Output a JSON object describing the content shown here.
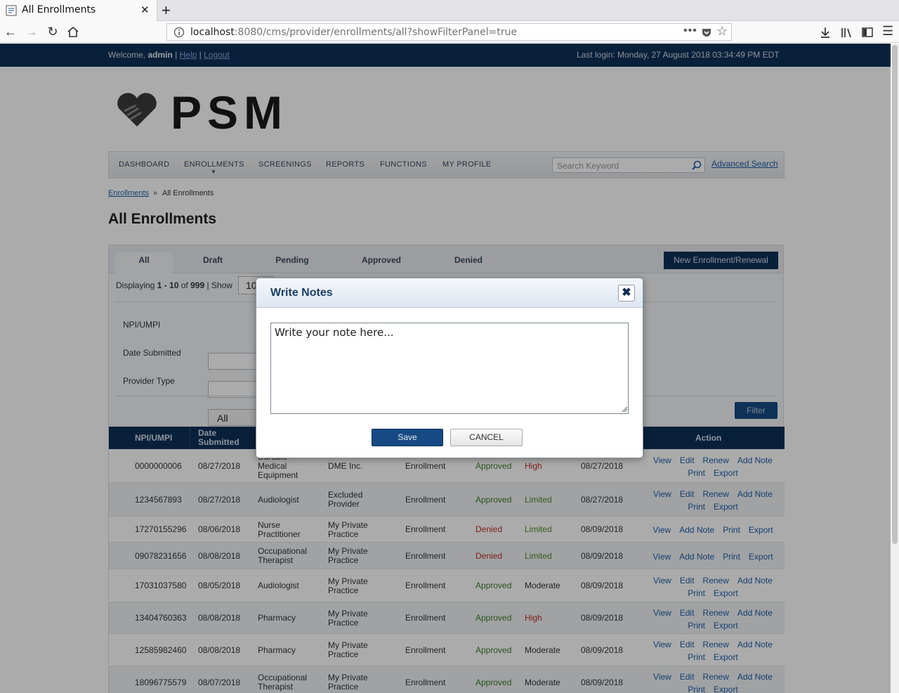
{
  "browser": {
    "tab_title": "All Enrollments",
    "url_host": "localhost",
    "url_rest": ":8080/cms/provider/enrollments/all?showFilterPanel=true"
  },
  "topbar": {
    "welcome": "Welcome,",
    "user": "admin",
    "help": "Help",
    "logout": "Logout",
    "last_login": "Last login: Monday, 27 August 2018 03:34:49 PM EDT"
  },
  "logo": {
    "text": "PSM"
  },
  "menu": {
    "items": [
      "DASHBOARD",
      "ENROLLMENTS",
      "SCREENINGS",
      "REPORTS",
      "FUNCTIONS",
      "MY PROFILE"
    ],
    "search_placeholder": "Search Keyword",
    "advanced_search": "Advanced Search"
  },
  "breadcrumb": {
    "link": "Enrollments",
    "sep": "»",
    "current": "All Enrollments"
  },
  "page_title": "All Enrollments",
  "tabs": [
    "All",
    "Draft",
    "Pending",
    "Approved",
    "Denied"
  ],
  "new_enrollment": "New Enrollment/Renewal",
  "display": {
    "prefix": "Displaying",
    "range": "1 - 10",
    "of": "of",
    "total": "999",
    "show": "| Show",
    "show_value": "10"
  },
  "filters": {
    "npi": "NPI/UMPI",
    "date": "Date Submitted",
    "provider_type": "Provider Type",
    "provider_type_value": "All",
    "filter_btn": "Filter"
  },
  "table": {
    "headers": [
      "NPI/UMPI",
      "Date Submitted",
      "Action"
    ],
    "rows": [
      {
        "npi": "0000000006",
        "date": "08/27/2018",
        "type": "Durable Medical Equipment",
        "name": "DME Inc.",
        "req": "Enrollment",
        "status": "Approved",
        "risk": "High",
        "updated": "08/27/2018",
        "actions": [
          "View",
          "Edit",
          "Renew",
          "Add Note",
          "Print",
          "Export"
        ]
      },
      {
        "npi": "1234567893",
        "date": "08/27/2018",
        "type": "Audiologist",
        "name": "Excluded Provider",
        "req": "Enrollment",
        "status": "Approved",
        "risk": "Limited",
        "updated": "08/27/2018",
        "actions": [
          "View",
          "Edit",
          "Renew",
          "Add Note",
          "Print",
          "Export"
        ]
      },
      {
        "npi": "17270155296",
        "date": "08/06/2018",
        "type": "Nurse Practitioner",
        "name": "My Private Practice",
        "req": "Enrollment",
        "status": "Denied",
        "risk": "Limited",
        "updated": "08/09/2018",
        "actions": [
          "View",
          "Add Note",
          "Print",
          "Export"
        ]
      },
      {
        "npi": "09078231656",
        "date": "08/08/2018",
        "type": "Occupational Therapist",
        "name": "My Private Practice",
        "req": "Enrollment",
        "status": "Denied",
        "risk": "Limited",
        "updated": "08/09/2018",
        "actions": [
          "View",
          "Add Note",
          "Print",
          "Export"
        ]
      },
      {
        "npi": "17031037580",
        "date": "08/05/2018",
        "type": "Audiologist",
        "name": "My Private Practice",
        "req": "Enrollment",
        "status": "Approved",
        "risk": "Moderate",
        "updated": "08/09/2018",
        "actions": [
          "View",
          "Edit",
          "Renew",
          "Add Note",
          "Print",
          "Export"
        ]
      },
      {
        "npi": "13404760363",
        "date": "08/08/2018",
        "type": "Pharmacy",
        "name": "My Private Practice",
        "req": "Enrollment",
        "status": "Approved",
        "risk": "High",
        "updated": "08/09/2018",
        "actions": [
          "View",
          "Edit",
          "Renew",
          "Add Note",
          "Print",
          "Export"
        ]
      },
      {
        "npi": "12585982460",
        "date": "08/08/2018",
        "type": "Pharmacy",
        "name": "My Private Practice",
        "req": "Enrollment",
        "status": "Approved",
        "risk": "Moderate",
        "updated": "08/09/2018",
        "actions": [
          "View",
          "Edit",
          "Renew",
          "Add Note",
          "Print",
          "Export"
        ]
      },
      {
        "npi": "18096775579",
        "date": "08/07/2018",
        "type": "Occupational Therapist",
        "name": "My Private Practice",
        "req": "Enrollment",
        "status": "Approved",
        "risk": "Moderate",
        "updated": "08/09/2018",
        "actions": [
          "View",
          "Edit",
          "Renew",
          "Add Note",
          "Print",
          "Export"
        ]
      }
    ]
  },
  "modal": {
    "title": "Write Notes",
    "close": "✖",
    "textarea_value": "Write your note here...",
    "save": "Save",
    "cancel": "CANCEL"
  },
  "icons": {
    "tab_favicon": "page-icon",
    "back": "back-arrow-icon",
    "forward": "forward-arrow-icon",
    "reload": "reload-icon",
    "home": "home-icon",
    "info": "info-icon",
    "more": "more-icon",
    "pocket": "pocket-icon",
    "bookmark": "star-icon",
    "downloads": "download-icon",
    "library": "library-icon",
    "sidebar": "sidebar-icon",
    "menu": "hamburger-icon",
    "search": "magnifier-icon",
    "logo": "heart-hands-icon"
  },
  "colors": {
    "brand_navy": "#0e3058",
    "button_blue": "#174a84",
    "link_blue": "#1d5ea8",
    "approved": "#3f7b2e",
    "denied": "#b8302a"
  }
}
